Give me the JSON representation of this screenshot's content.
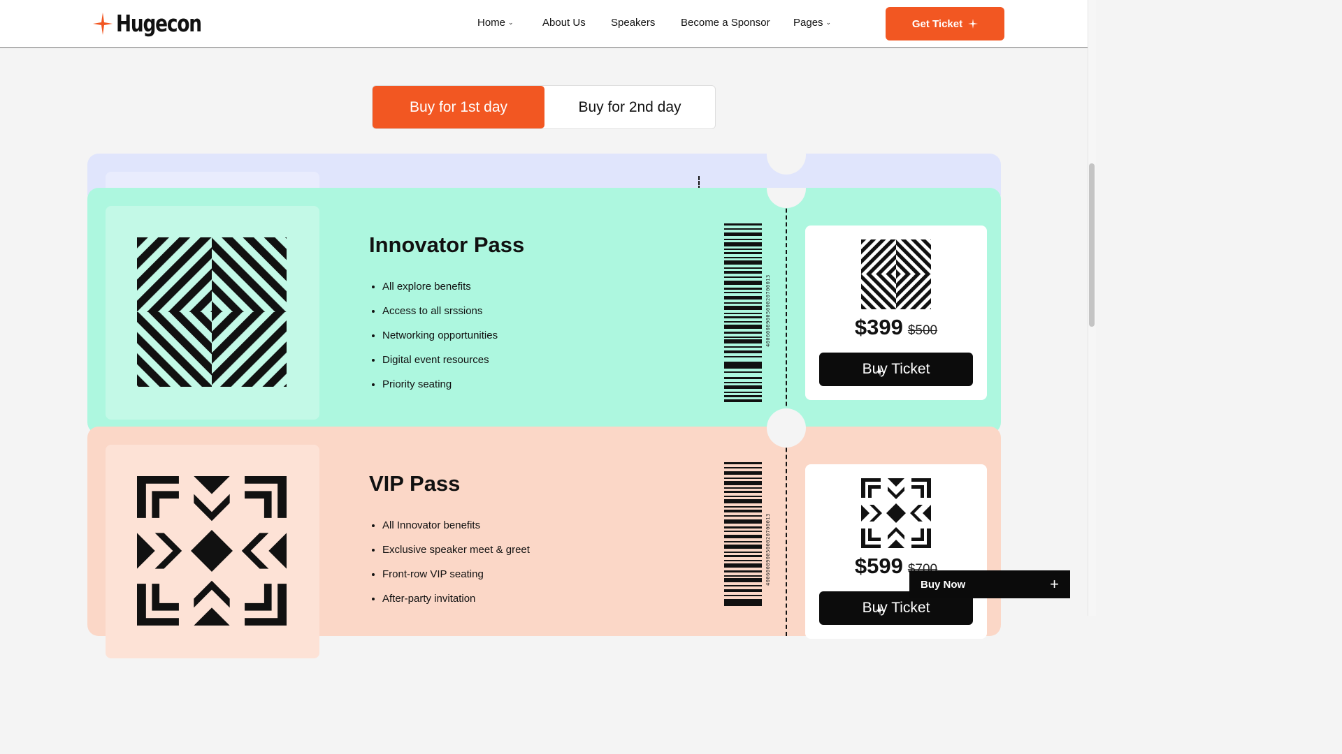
{
  "header": {
    "logo_text": "Hugecon",
    "nav": [
      {
        "label": "Home",
        "has_dropdown": true
      },
      {
        "label": "About Us",
        "has_dropdown": false
      },
      {
        "label": "Speakers",
        "has_dropdown": false
      },
      {
        "label": "Become a Sponsor",
        "has_dropdown": false
      },
      {
        "label": "Pages",
        "has_dropdown": true
      }
    ],
    "cta_label": "Get Ticket"
  },
  "tabs": {
    "day1": "Buy for 1st day",
    "day2": "Buy for 2nd day",
    "active": "day1"
  },
  "tickets": [
    {
      "title": "Innovator Pass",
      "features": [
        "All explore benefits",
        "Access to all srssions",
        "Networking opportunities",
        "Digital event resources",
        "Priority seating"
      ],
      "price": "$399",
      "old_price": "$500",
      "barcode_number": "4006008900500020700013",
      "buy_label": "Buy Ticket",
      "background": "#adf7df"
    },
    {
      "title": "VIP Pass",
      "features": [
        "All Innovator benefits",
        "Exclusive speaker meet & greet",
        "Front-row VIP seating",
        "After-party invitation"
      ],
      "price": "$599",
      "old_price": "$700",
      "barcode_number": "4006008900500020700013",
      "buy_label": "Buy Ticket",
      "background": "#fbd7c7"
    }
  ],
  "floating_button": {
    "label": "Buy Now"
  },
  "colors": {
    "accent": "#f25722",
    "dark": "#0c0c0c",
    "stub_card": "#e0e5fc"
  },
  "icons": [
    "sparkle-logo-icon",
    "chevron-down-icon",
    "sparkle-icon",
    "diagonal-weave-icon",
    "starburst-pattern-icon",
    "barcode-icon",
    "plus-icon"
  ]
}
